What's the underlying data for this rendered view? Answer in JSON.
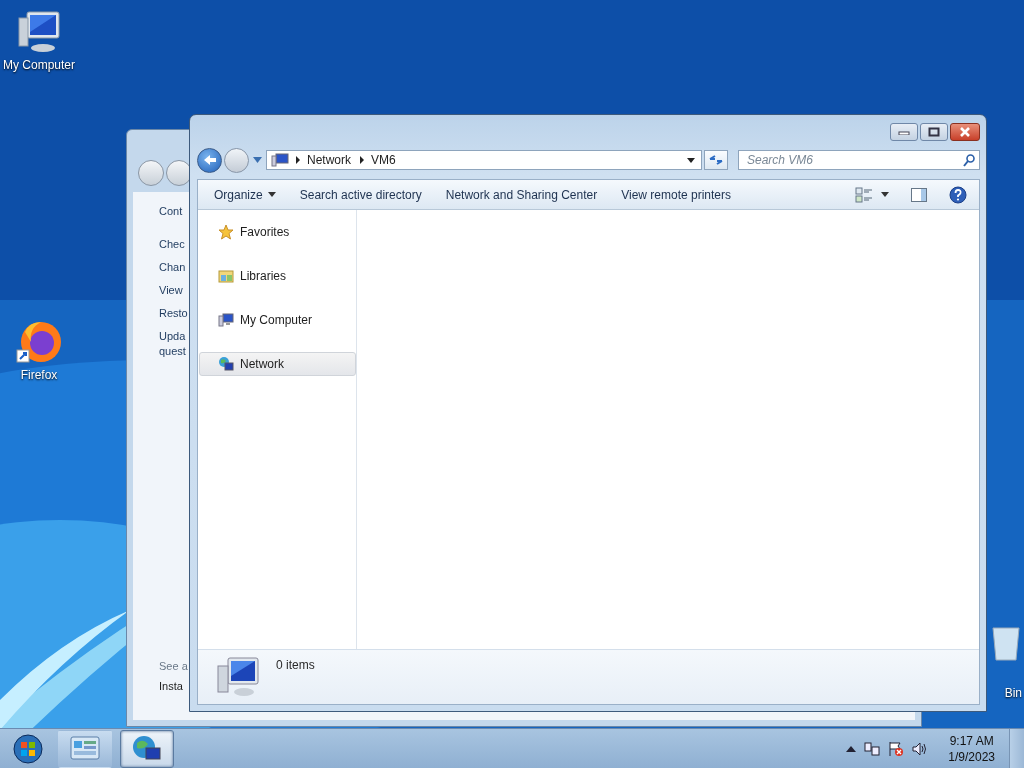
{
  "desktop_icons": [
    {
      "label": "My Computer",
      "kind": "computer"
    },
    {
      "label": "Firefox",
      "kind": "firefox"
    },
    {
      "label": "Bin",
      "kind": "recycle"
    }
  ],
  "background_window": {
    "lines": [
      "Cont",
      "Chec",
      "Chan",
      "View",
      "Resto",
      "Upda",
      "quest"
    ],
    "footer": [
      "See a",
      "Insta"
    ]
  },
  "explorer": {
    "breadcrumb": [
      "Network",
      "VM6"
    ],
    "search": {
      "placeholder": "Search VM6"
    },
    "toolbar": [
      {
        "label": "Organize",
        "kind": "menu"
      },
      {
        "label": "Search active directory",
        "kind": "command"
      },
      {
        "label": "Network and Sharing Center",
        "kind": "command"
      },
      {
        "label": "View remote printers",
        "kind": "command"
      }
    ],
    "nav_items": [
      {
        "label": "Favorites",
        "kind": "star",
        "selected": false
      },
      {
        "label": "Libraries",
        "kind": "libraries",
        "selected": false
      },
      {
        "label": "My Computer",
        "kind": "computer",
        "selected": false
      },
      {
        "label": "Network",
        "kind": "network",
        "selected": true
      }
    ],
    "status": "0 items"
  },
  "taskbar": {
    "buttons": [
      {
        "kind": "control-panel",
        "active": false
      },
      {
        "kind": "network",
        "active": true
      }
    ],
    "time": "9:17 AM",
    "date": "1/9/2023"
  }
}
